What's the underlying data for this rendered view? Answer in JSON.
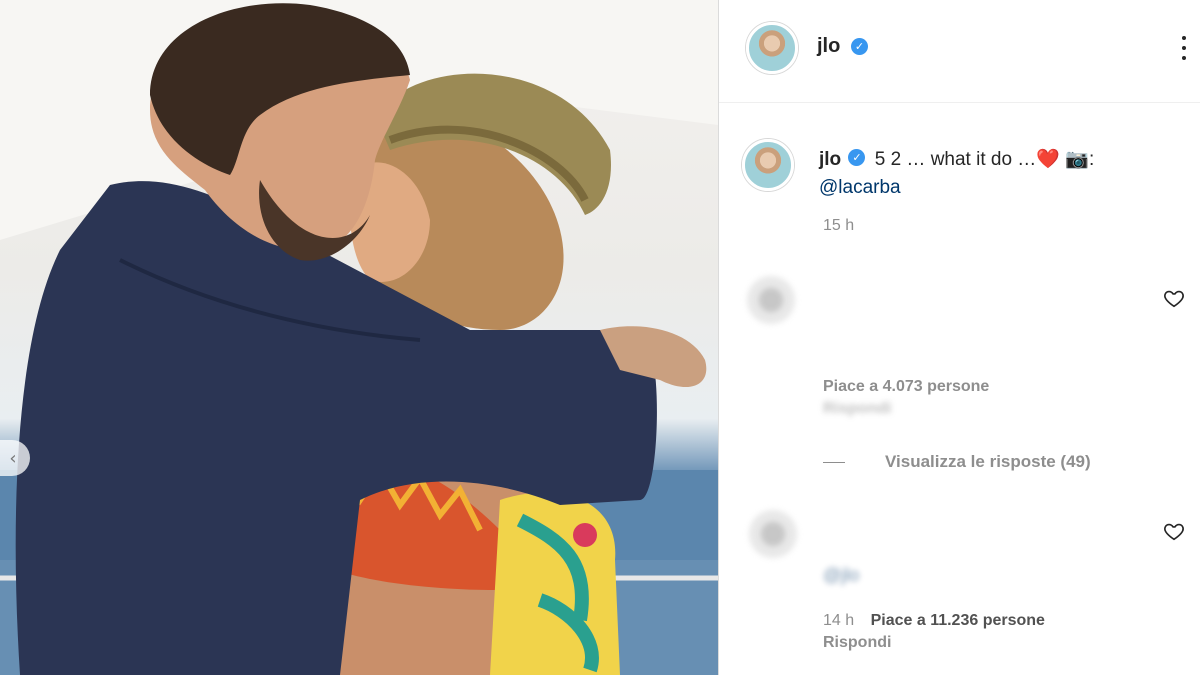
{
  "post": {
    "username": "jlo",
    "verified": true,
    "caption_username": "jlo",
    "caption_text": "5 2 … what it do …",
    "caption_emoji_heart": "❤️",
    "caption_emoji_camera": "📷",
    "caption_colon": ":",
    "caption_mention": "@lacarba",
    "time_ago": "15 h"
  },
  "comments": [
    {
      "username": "",
      "text": "",
      "likes_label": "Piace a 4.073 persone",
      "reply_label": "Rispondi",
      "view_replies_label": "Visualizza le risposte (49)"
    },
    {
      "text": "",
      "mention": "@jlo",
      "time_ago": "14 h",
      "likes_label": "Piace a 11.236 persone",
      "reply_label": "Rispondi"
    }
  ],
  "colors": {
    "verified": "#3897f0",
    "mention": "#00376b",
    "muted": "#8e8e8e",
    "text": "#262626"
  },
  "icons": [
    "more-options-icon",
    "verified-badge-icon",
    "heart-outline-icon",
    "chevron-left-icon"
  ]
}
